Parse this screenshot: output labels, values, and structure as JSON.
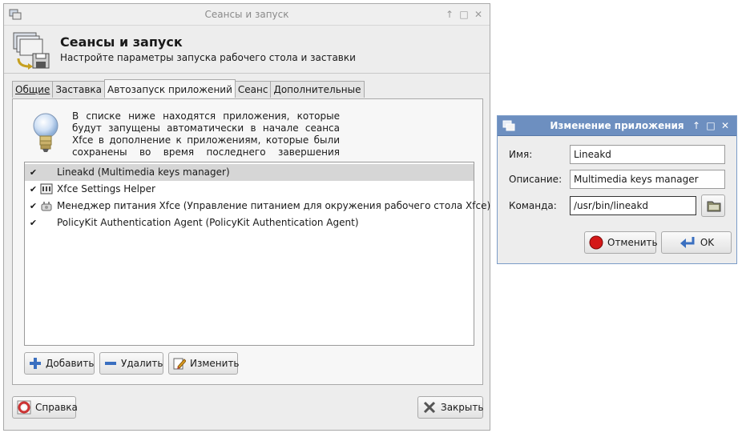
{
  "main_window": {
    "title": "Сеансы и запуск",
    "header_title": "Сеансы и запуск",
    "header_subtitle": "Настройте параметры запуска рабочего стола и заставки",
    "tabs": [
      {
        "label": "Общие",
        "active": false
      },
      {
        "label": "Заставка",
        "active": false
      },
      {
        "label": "Автозапуск приложений",
        "active": true
      },
      {
        "label": "Сеанс",
        "active": false
      },
      {
        "label": "Дополнительные",
        "active": false
      }
    ],
    "info_text": "В списке ниже находятся приложения, которые будут запущены автоматически в начале сеанса Xfce в дополнение к приложениям, которые были сохранены во время последнего завершения сеанса:",
    "apps": [
      {
        "label": "Lineakd (Multimedia keys manager)",
        "checked": true,
        "selected": true,
        "icon": "none"
      },
      {
        "label": "Xfce Settings Helper",
        "checked": true,
        "selected": false,
        "icon": "settings-helper-icon"
      },
      {
        "label": "Менеджер питания Xfce (Управление питанием для окружения рабочего стола Xfce)",
        "checked": true,
        "selected": false,
        "icon": "power-manager-icon"
      },
      {
        "label": "PolicyKit Authentication Agent (PolicyKit Authentication Agent)",
        "checked": true,
        "selected": false,
        "icon": "none"
      }
    ],
    "buttons": {
      "add": "Добавить",
      "remove": "Удалить",
      "edit": "Изменить",
      "help": "Справка",
      "close": "Закрыть"
    }
  },
  "edit_dialog": {
    "title": "Изменение приложения",
    "name_label": "Имя:",
    "name_value": "Lineakd",
    "description_label": "Описание:",
    "description_value": "Multimedia keys manager",
    "command_label": "Команда:",
    "command_value": "/usr/bin/lineakd",
    "cancel_label": "Отменить",
    "ok_label": "OK"
  },
  "colors": {
    "dialog_titlebar": "#6d8fc0",
    "selection": "#d6d6d6",
    "window_bg": "#ededed"
  }
}
